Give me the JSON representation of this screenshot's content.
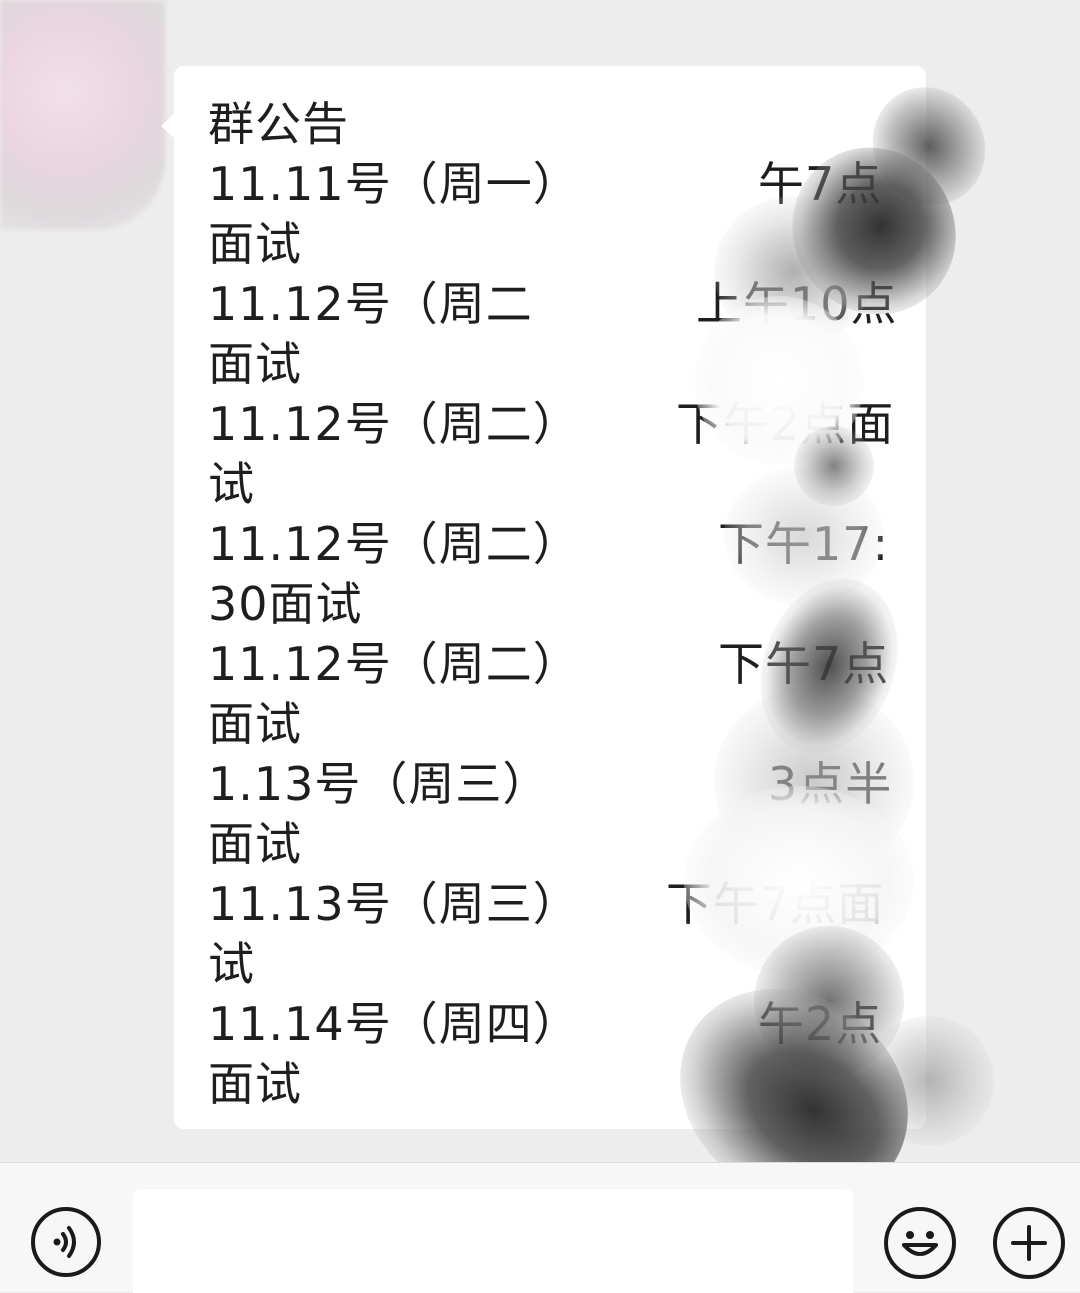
{
  "message": {
    "lines": [
      "群公告",
      "11.11号（周一）",
      "午7点",
      "面试",
      "11.12号（周二",
      "上午10点",
      "面试",
      "11.12号（周二）",
      "下午2点面",
      "试",
      "11.12号（周二）",
      "下午17:",
      "30面试",
      "11.12号（周二）",
      "下午7点",
      "面试",
      "1.13号（周三）",
      "3点半",
      "面试",
      "11.13号（周三）",
      "下午7点面",
      "试",
      "11.14号（周四）",
      "午2点",
      "面试"
    ]
  },
  "input_bar": {
    "voice_icon": "voice-icon",
    "input_value": "",
    "emoji_icon": "emoji-icon",
    "plus_icon": "plus-icon"
  }
}
